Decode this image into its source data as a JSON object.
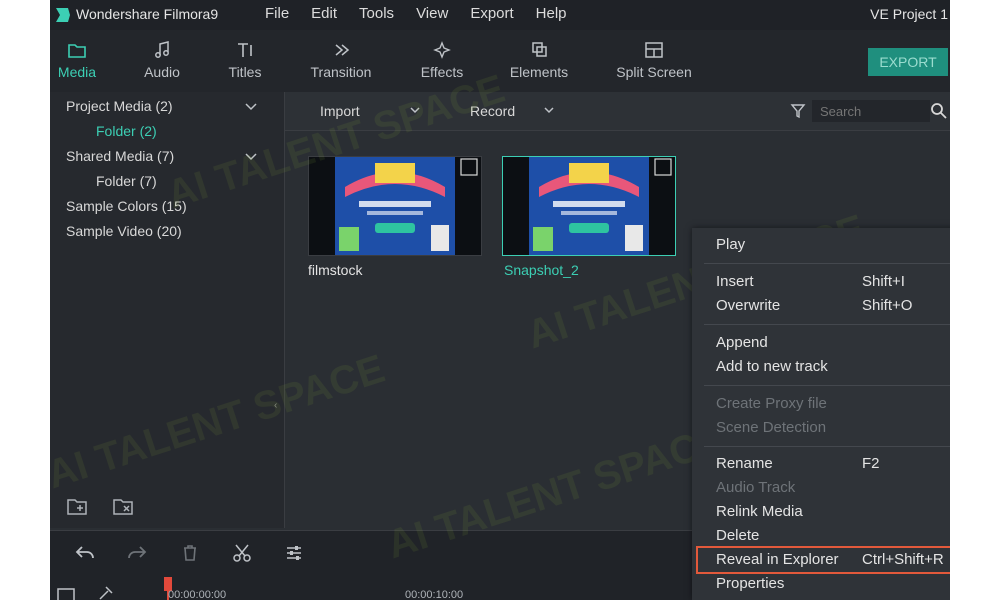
{
  "window": {
    "app_title": "Wondershare Filmora9",
    "project": "VE Project 1"
  },
  "menu": [
    "File",
    "Edit",
    "Tools",
    "View",
    "Export",
    "Help"
  ],
  "toolbar": {
    "tabs": [
      "Media",
      "Audio",
      "Titles",
      "Transition",
      "Effects",
      "Elements",
      "Split Screen"
    ],
    "active": "Media",
    "export_label": "EXPORT"
  },
  "library": {
    "items": [
      {
        "label": "Project Media (2)",
        "expandable": true
      },
      {
        "label": "Folder (2)",
        "selected": true
      },
      {
        "label": "Shared Media (7)",
        "expandable": true
      },
      {
        "label": "Folder (7)"
      },
      {
        "label": "Sample Colors (15)"
      },
      {
        "label": "Sample Video (20)"
      }
    ]
  },
  "media_bar": {
    "import_label": "Import",
    "record_label": "Record",
    "search_placeholder": "Search"
  },
  "media_items": [
    {
      "name": "filmstock",
      "selected": false
    },
    {
      "name": "Snapshot_2",
      "selected": true
    }
  ],
  "timeline": {
    "timecodes": [
      "00:00:00:00",
      "00:00:10:00"
    ]
  },
  "context_menu": {
    "items": [
      {
        "label": "Play"
      },
      {
        "label": "Insert",
        "shortcut": "Shift+I"
      },
      {
        "label": "Overwrite",
        "shortcut": "Shift+O"
      },
      {
        "label": "Append"
      },
      {
        "label": "Add to new track"
      },
      {
        "label": "Create Proxy file",
        "disabled": true
      },
      {
        "label": "Scene Detection",
        "disabled": true
      },
      {
        "label": "Rename",
        "shortcut": "F2"
      },
      {
        "label": "Audio Track",
        "disabled": true,
        "submenu": true
      },
      {
        "label": "Relink Media"
      },
      {
        "label": "Delete"
      },
      {
        "label": "Reveal in Explorer",
        "shortcut": "Ctrl+Shift+R",
        "highlighted": true
      },
      {
        "label": "Properties"
      }
    ]
  },
  "watermark": "AI TALENT SPACE",
  "colors": {
    "accent": "#3ccfb4",
    "highlight_box": "#e2593b",
    "panel": "#2a2e33"
  }
}
